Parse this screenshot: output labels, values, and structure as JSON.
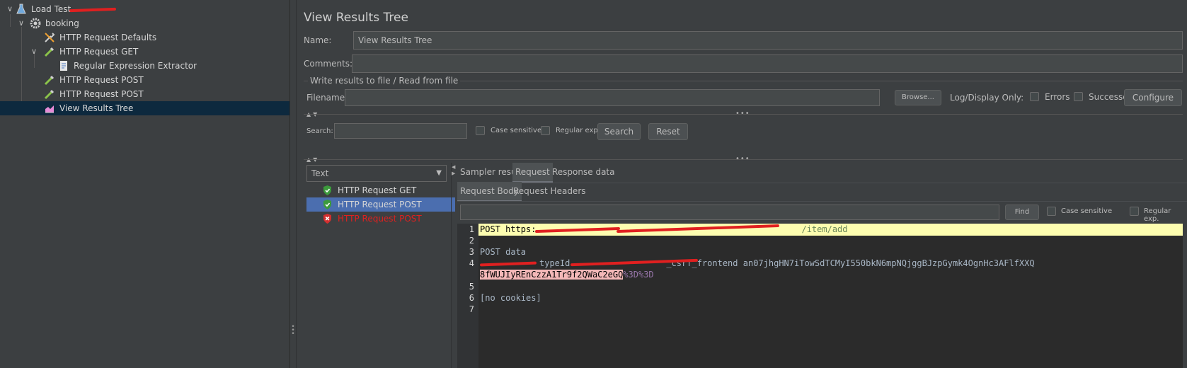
{
  "tree": {
    "items": [
      {
        "label": "Load Test",
        "level": 0,
        "expanded": true,
        "icon": "flask-icon"
      },
      {
        "label": "booking",
        "level": 1,
        "expanded": true,
        "icon": "gear-icon"
      },
      {
        "label": "HTTP Request Defaults",
        "level": 2,
        "icon": "wrench-icon"
      },
      {
        "label": "HTTP Request GET",
        "level": 2,
        "expanded": true,
        "icon": "pipette-icon"
      },
      {
        "label": "Regular Expression Extractor",
        "level": 3,
        "icon": "document-icon"
      },
      {
        "label": "HTTP Request POST",
        "level": 2,
        "icon": "pipette-icon"
      },
      {
        "label": "HTTP Request POST",
        "level": 2,
        "icon": "pipette-icon"
      },
      {
        "label": "View Results Tree",
        "level": 2,
        "selected": true,
        "icon": "chart-icon"
      }
    ]
  },
  "panel": {
    "title": "View Results Tree",
    "name_label": "Name:",
    "name_value": "View Results Tree",
    "comments_label": "Comments:",
    "comments_value": "",
    "file_group_label": "Write results to file / Read from file",
    "filename_label": "Filename",
    "filename_value": "",
    "browse_label": "Browse...",
    "log_display_label": "Log/Display Only:",
    "errors_label": "Errors",
    "successes_label": "Successes",
    "configure_label": "Configure",
    "search_label": "Search:",
    "search_value": "",
    "case_sensitive_label": "Case sensitive",
    "regex_label": "Regular exp.",
    "search_button": "Search",
    "reset_button": "Reset"
  },
  "results": {
    "renderer": "Text",
    "items": [
      {
        "label": "HTTP Request GET",
        "status": "success"
      },
      {
        "label": "HTTP Request POST",
        "status": "success",
        "selected": true
      },
      {
        "label": "HTTP Request POST",
        "status": "failure"
      }
    ]
  },
  "tabs": {
    "main": [
      "Sampler result",
      "Request",
      "Response data"
    ],
    "main_active": 1,
    "sub": [
      "Request Body",
      "Request Headers"
    ],
    "sub_active": 0
  },
  "find": {
    "value": "",
    "button": "Find",
    "case_sensitive_label": "Case sensitive",
    "regex_label": "Regular exp."
  },
  "editor": {
    "line_numbers": [
      "1",
      "2",
      "3",
      "4",
      "5",
      "6",
      "7"
    ],
    "line1_prefix": "POST https:",
    "line1_tail": "/item/add",
    "line3": "POST data",
    "line4_visible": "typeId",
    "line4_visible2": "_csrf_frontend",
    "line4_token": "an07jhgHN7iTowSdTCMyI550bkN6mpNQjggBJzpGymk4OgnHc3AFlfXXQ",
    "line4b_token": "8fWUJIyREnCzzA1Tr9f2QWaC2eGQ",
    "line4b_suffix": "%3D%3D",
    "line6": "[no cookies]"
  },
  "colors": {
    "selection_tree": "#0d293e",
    "selection_list": "#4b6eaf",
    "failure_text": "#e0201f",
    "success_icon": "#3c9a3c",
    "line_highlight": "#fdfdb0"
  }
}
